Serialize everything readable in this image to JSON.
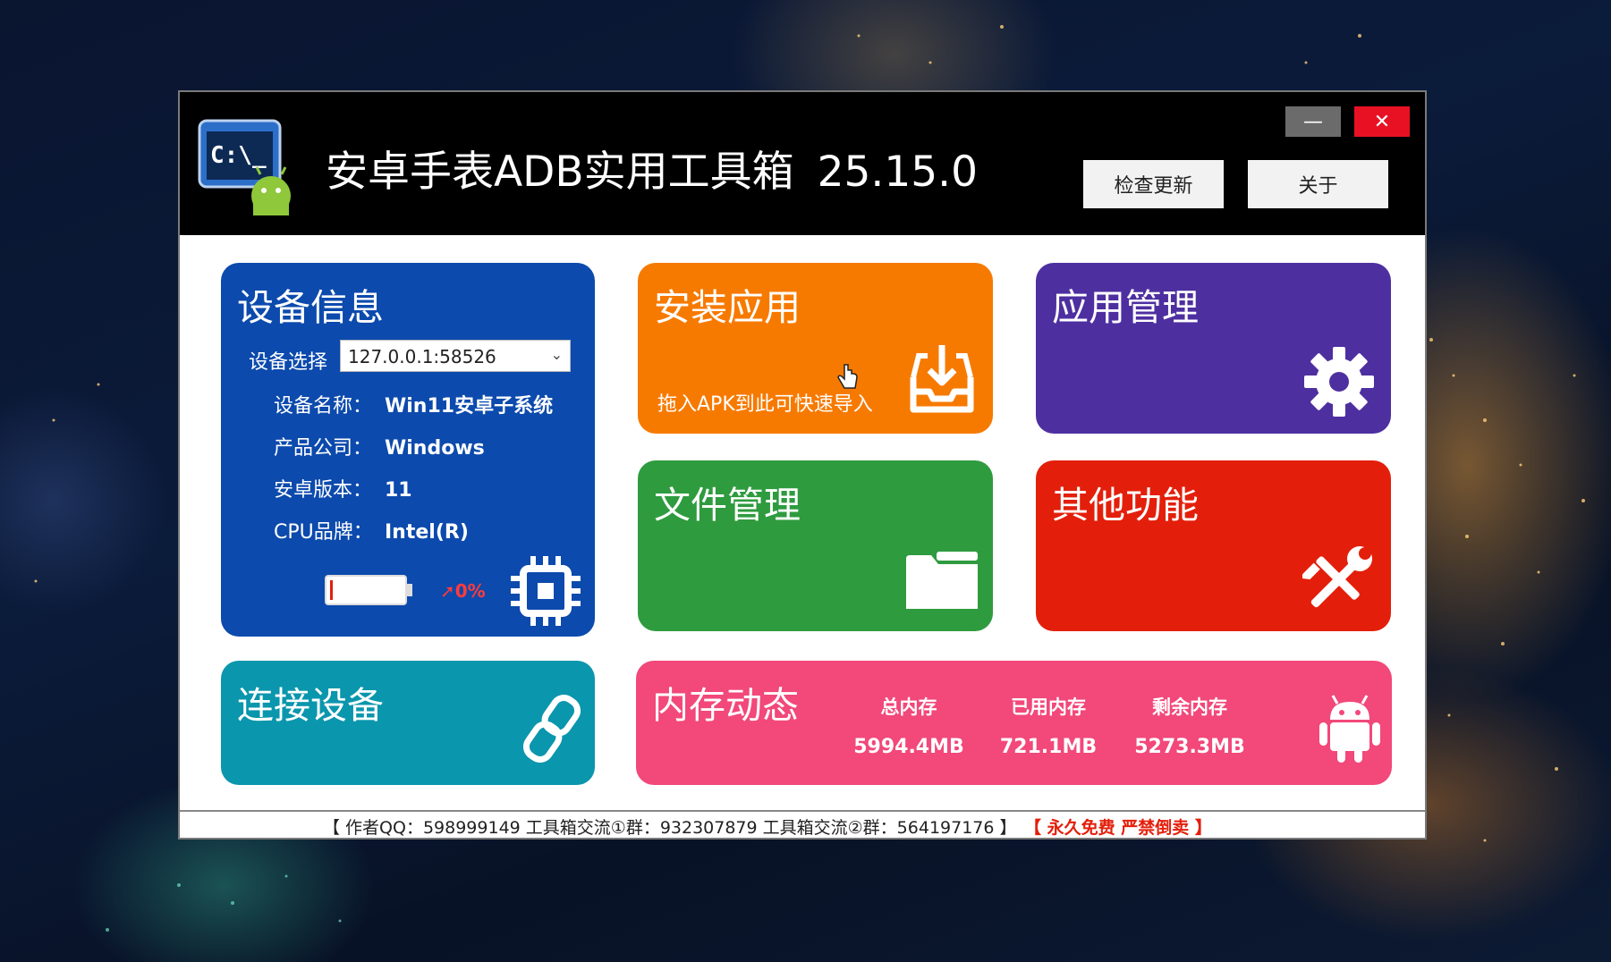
{
  "window": {
    "title": "安卓手表ADB实用工具箱",
    "version": "25.15.0",
    "minimize_glyph": "—",
    "close_glyph": "✕",
    "check_update_label": "检查更新",
    "about_label": "关于"
  },
  "device_info": {
    "title": "设备信息",
    "select_label": "设备选择",
    "select_value": "127.0.0.1:58526",
    "rows": [
      {
        "key": "设备名称：",
        "value": "Win11安卓子系统"
      },
      {
        "key": "产品公司：",
        "value": "Windows"
      },
      {
        "key": "安卓版本：",
        "value": "11"
      },
      {
        "key": "CPU品牌：",
        "value": "Intel(R)"
      }
    ],
    "battery_percent_text": "0%",
    "battery_level": 0,
    "icon": "chip-icon"
  },
  "tiles": {
    "install": {
      "title": "安装应用",
      "hint": "拖入APK到此可快速导入",
      "icon": "inbox-download-icon"
    },
    "app_manage": {
      "title": "应用管理",
      "icon": "gear-icon"
    },
    "file_manage": {
      "title": "文件管理",
      "icon": "folder-icon"
    },
    "other": {
      "title": "其他功能",
      "icon": "tools-icon"
    },
    "connect": {
      "title": "连接设备",
      "icon": "link-icon"
    }
  },
  "memory": {
    "title": "内存动态",
    "total_label": "总内存",
    "total_value": "5994.4MB",
    "used_label": "已用内存",
    "used_value": "721.1MB",
    "free_label": "剩余内存",
    "free_value": "5273.3MB",
    "icon": "android-icon"
  },
  "status_bar": {
    "info": "【 作者QQ：598999149 工具箱交流①群：932307879 工具箱交流②群：564197176 】",
    "notice": "【 永久免费 严禁倒卖 】"
  },
  "colors": {
    "device_tile": "#0c4aad",
    "install_tile": "#f77a00",
    "app_manage_tile": "#4e2fa0",
    "file_manage_tile": "#2f9b3f",
    "other_tile": "#e31f0b",
    "connect_tile": "#0a96ad",
    "memory_tile": "#f2487a",
    "close_button": "#e81123"
  }
}
